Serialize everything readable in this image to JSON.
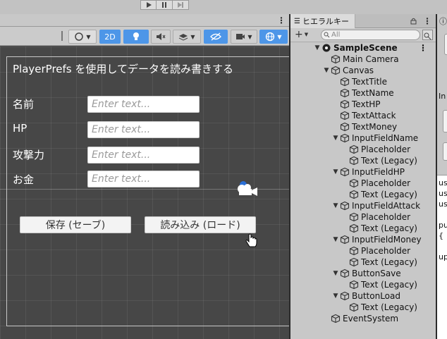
{
  "scene_toolbar": {
    "btn_2d": "2D"
  },
  "game_ui": {
    "title": "PlayerPrefs を使用してデータを読み書きする",
    "fields": [
      {
        "label": "名前",
        "placeholder": "Enter text..."
      },
      {
        "label": "HP",
        "placeholder": "Enter text..."
      },
      {
        "label": "攻撃力",
        "placeholder": "Enter text..."
      },
      {
        "label": "お金",
        "placeholder": "Enter text..."
      }
    ],
    "save_button": "保存 (セーブ)",
    "load_button": "読み込み (ロード)"
  },
  "hierarchy": {
    "tab_label": "ヒエラルキー",
    "add_label": "+",
    "search_placeholder": "All",
    "items": [
      {
        "label": "SampleScene"
      },
      {
        "label": "Main Camera"
      },
      {
        "label": "Canvas"
      },
      {
        "label": "TextTitle"
      },
      {
        "label": "TextName"
      },
      {
        "label": "TextHP"
      },
      {
        "label": "TextAttack"
      },
      {
        "label": "TextMoney"
      },
      {
        "label": "InputFieldName"
      },
      {
        "label": "Placeholder"
      },
      {
        "label": "Text (Legacy)"
      },
      {
        "label": "InputFieldHP"
      },
      {
        "label": "Placeholder"
      },
      {
        "label": "Text (Legacy)"
      },
      {
        "label": "InputFieldAttack"
      },
      {
        "label": "Placeholder"
      },
      {
        "label": "Text (Legacy)"
      },
      {
        "label": "InputFieldMoney"
      },
      {
        "label": "Placeholder"
      },
      {
        "label": "Text (Legacy)"
      },
      {
        "label": "ButtonSave"
      },
      {
        "label": "Text (Legacy)"
      },
      {
        "label": "ButtonLoad"
      },
      {
        "label": "Text (Legacy)"
      },
      {
        "label": "EventSystem"
      }
    ]
  },
  "inspector": {
    "partial_in": "In",
    "code_lines": [
      "us",
      "us",
      "us",
      "",
      "pu",
      "{",
      "",
      "up"
    ]
  }
}
